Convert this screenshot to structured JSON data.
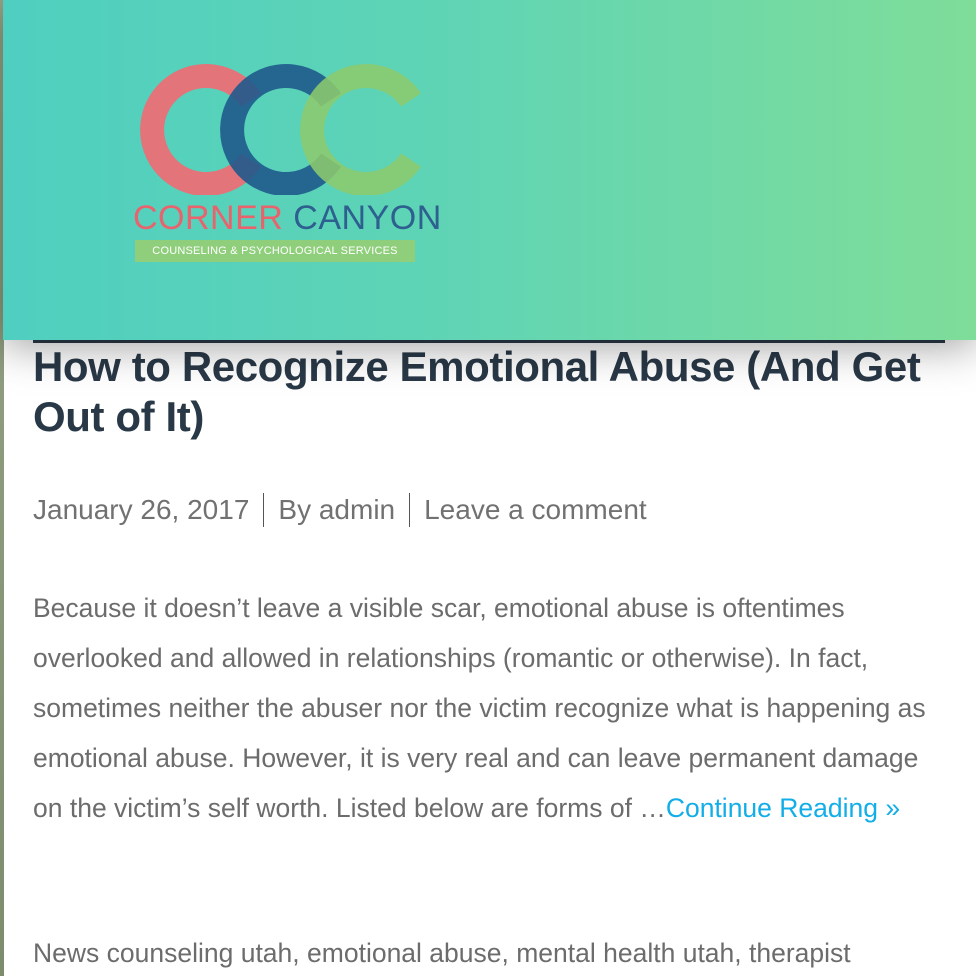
{
  "header": {
    "logo": {
      "name_part1": "CORNER",
      "name_part2": "CANYON",
      "tagline": "COUNSELING & PSYCHOLOGICAL SERVICES",
      "colors": {
        "red": "#ef6b74",
        "blue": "#1f5a8c",
        "green": "#8cc96d"
      }
    },
    "gradient": {
      "start": "#4fcfc0",
      "end": "#7fdd99"
    }
  },
  "post": {
    "title": "How to Recognize Emotional Abuse (And Get Out of It)",
    "date": "January 26, 2017",
    "author": "By admin",
    "comment_link": "Leave a comment",
    "excerpt": "Because it doesn’t leave a visible scar, emotional abuse is oftentimes overlooked and allowed in relationships (romantic or otherwise). In fact, sometimes neither the abuser nor the victim recognize what is happening as emotional abuse. However, it is very real and can leave permanent damage on the victim’s self worth. Listed below are forms of …",
    "continue_link": "Continue Reading »",
    "category": "News",
    "tags": [
      "counseling utah",
      "emotional abuse",
      "mental health utah",
      "therapist"
    ]
  },
  "colors": {
    "title": "#293847",
    "meta_text": "#717171",
    "body_text": "#6c6c6c",
    "link": "#13aee8"
  }
}
